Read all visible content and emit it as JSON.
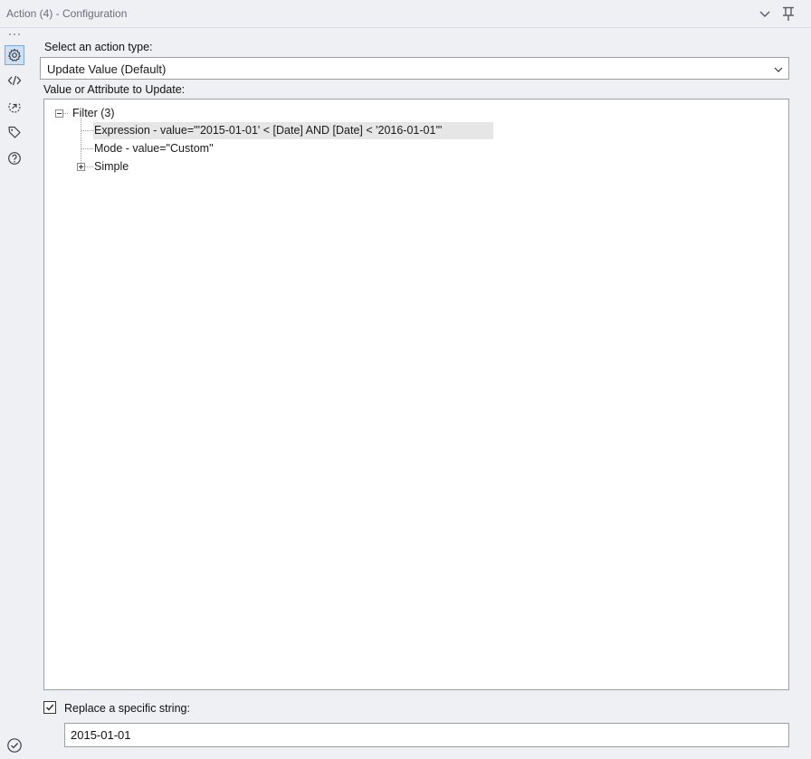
{
  "window": {
    "title": "Action (4) - Configuration",
    "collapse_icon": "chevron-down-icon",
    "pin_icon": "pin-icon"
  },
  "sidebar": {
    "items": [
      {
        "name": "configuration",
        "icon": "gear-icon",
        "active": true
      },
      {
        "name": "xml",
        "icon": "code-icon",
        "active": false
      },
      {
        "name": "connection-progress",
        "icon": "arrow-circle-icon",
        "active": false
      },
      {
        "name": "annotation",
        "icon": "tag-icon",
        "active": false
      },
      {
        "name": "help",
        "icon": "question-circle-icon",
        "active": false
      }
    ],
    "status_icon": "check-circle-icon"
  },
  "action_type": {
    "label": "Select an action type:",
    "selected": "Update Value (Default)"
  },
  "value_tree": {
    "label": "Value or Attribute to Update:",
    "root": {
      "label": "Filter (3)",
      "expanded": true,
      "children": [
        {
          "label": "Expression - value=\"'2015-01-01' < [Date] AND [Date] < '2016-01-01'\"",
          "selected": true
        },
        {
          "label": "Mode - value=\"Custom\"",
          "selected": false
        },
        {
          "label": "Simple",
          "expandable": true,
          "expanded": false
        }
      ]
    }
  },
  "replace": {
    "checked": true,
    "label": "Replace a specific string:",
    "value": "2015-01-01"
  },
  "colors": {
    "panel_bg": "#eef0f4",
    "active_icon_bg": "#cfe0f5",
    "icon_color": "#3c3f44",
    "selected_row_bg": "#e6e6e6"
  }
}
